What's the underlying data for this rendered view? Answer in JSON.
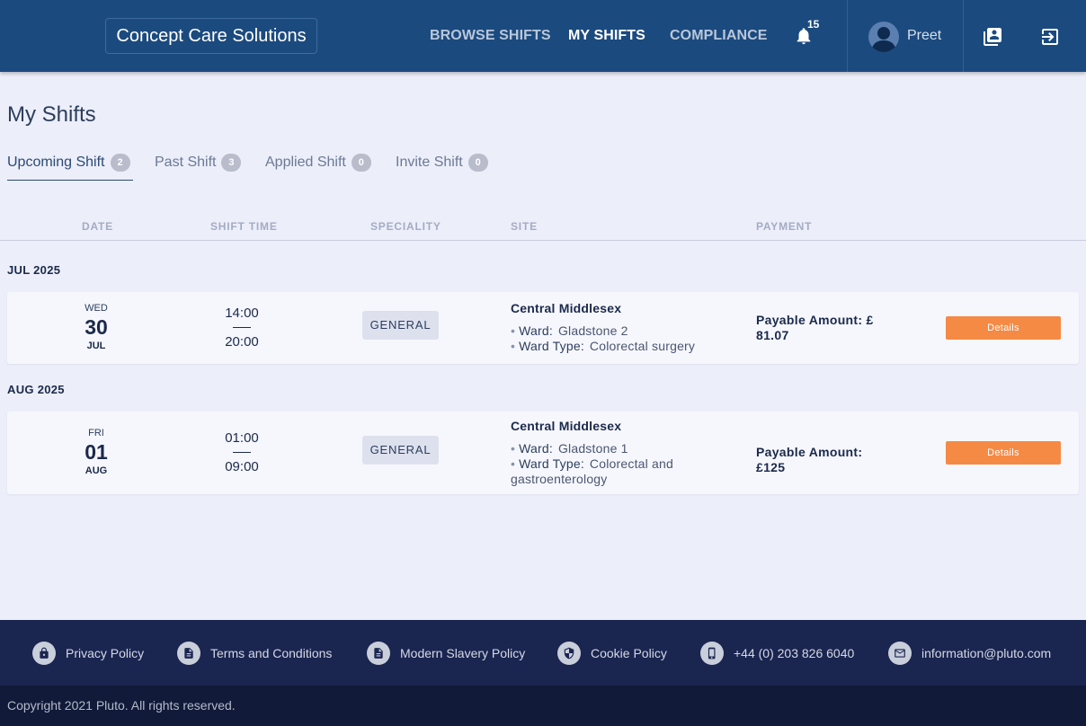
{
  "header": {
    "brand": "Concept Care Solutions",
    "nav": [
      {
        "label": "BROWSE SHIFTS",
        "active": false
      },
      {
        "label": "MY SHIFTS",
        "active": true
      },
      {
        "label": "COMPLIANCE",
        "active": false
      }
    ],
    "notification_count": "15",
    "user_name": "Preet",
    "icons": [
      "bell-icon",
      "user-avatar",
      "contacts-book-icon",
      "logout-icon"
    ],
    "background_color": "#1b4a7e"
  },
  "page": {
    "title": "My Shifts",
    "tabs": [
      {
        "label": "Upcoming Shift",
        "count": "2",
        "active": true
      },
      {
        "label": "Past Shift",
        "count": "3",
        "active": false
      },
      {
        "label": "Applied Shift",
        "count": "0",
        "active": false
      },
      {
        "label": "Invite Shift",
        "count": "0",
        "active": false
      }
    ],
    "columns": [
      "DATE",
      "SHIFT TIME",
      "SPECIALITY",
      "SITE",
      "PAYMENT"
    ]
  },
  "groups": [
    {
      "month": "JUL 2025",
      "shifts": [
        {
          "dow": "WED",
          "day": "30",
          "mon": "JUL",
          "start": "14:00",
          "end": "20:00",
          "speciality": "GENERAL",
          "site": "Central Middlesex",
          "ward_label": "Ward:",
          "ward": "Gladstone 2",
          "ward_type_label": "Ward Type:",
          "ward_type": "Colorectal surgery",
          "pay_label": "Payable Amount:",
          "pay": "£ 81.07",
          "details_label": "Details"
        }
      ]
    },
    {
      "month": "AUG 2025",
      "shifts": [
        {
          "dow": "FRI",
          "day": "01",
          "mon": "AUG",
          "start": "01:00",
          "end": "09:00",
          "speciality": "GENERAL",
          "site": "Central Middlesex",
          "ward_label": "Ward:",
          "ward": "Gladstone 1",
          "ward_type_label": "Ward Type:",
          "ward_type": "Colorectal and gastroenterology",
          "pay_label": "Payable Amount:",
          "pay": "£125",
          "details_label": "Details"
        }
      ]
    }
  ],
  "footer": {
    "links": [
      {
        "label": "Privacy Policy",
        "icon": "lock-icon"
      },
      {
        "label": "Terms and Conditions",
        "icon": "document-icon"
      },
      {
        "label": "Modern Slavery Policy",
        "icon": "document-icon"
      },
      {
        "label": "Cookie Policy",
        "icon": "shield-icon"
      },
      {
        "label": "+44 (0) 203 826 6040",
        "icon": "phone-icon"
      },
      {
        "label": "information@pluto.com",
        "icon": "mail-icon"
      }
    ],
    "copyright": "Copyright 2021 Pluto. All rights reserved."
  },
  "colors": {
    "accent": "#f58a45",
    "footer": "#1a2550",
    "page_bg": "#eceef9"
  }
}
